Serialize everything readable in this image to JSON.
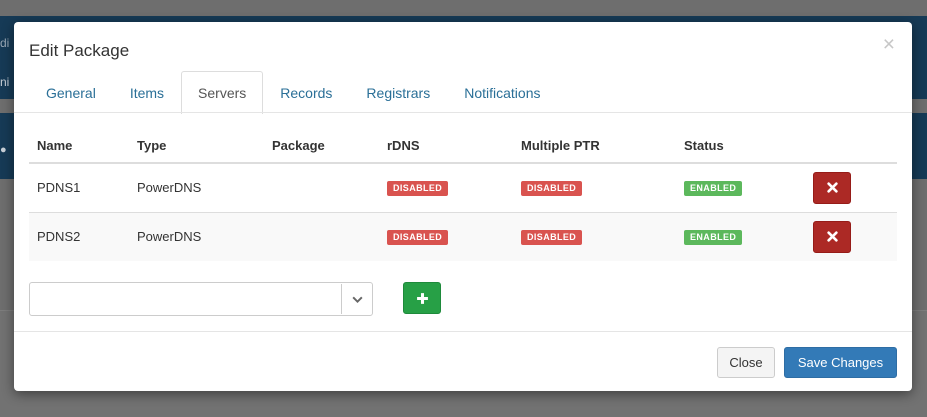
{
  "background": {
    "fragment_1": "di",
    "fragment_2": "ni"
  },
  "modal": {
    "title": "Edit Package",
    "close_glyph": "×"
  },
  "tabs": [
    {
      "label": "General",
      "active": false
    },
    {
      "label": "Items",
      "active": false
    },
    {
      "label": "Servers",
      "active": true
    },
    {
      "label": "Records",
      "active": false
    },
    {
      "label": "Registrars",
      "active": false
    },
    {
      "label": "Notifications",
      "active": false
    }
  ],
  "servers_table": {
    "columns": [
      "Name",
      "Type",
      "Package",
      "rDNS",
      "Multiple PTR",
      "Status"
    ],
    "rows": [
      {
        "name": "PDNS1",
        "type": "PowerDNS",
        "package": "",
        "rdns": "DISABLED",
        "multiple_ptr": "DISABLED",
        "status": "ENABLED"
      },
      {
        "name": "PDNS2",
        "type": "PowerDNS",
        "package": "",
        "rdns": "DISABLED",
        "multiple_ptr": "DISABLED",
        "status": "ENABLED"
      }
    ],
    "delete_icon": "times-icon"
  },
  "add_server": {
    "select_value": "",
    "button_icon": "plus-icon"
  },
  "footer": {
    "close_label": "Close",
    "save_label": "Save Changes"
  },
  "colors": {
    "disabled_badge": "#d9534f",
    "enabled_badge": "#5cb85c",
    "delete_button": "#ac2925",
    "add_button": "#27a046",
    "primary_button": "#337ab7",
    "tab_link": "#2a6f97"
  }
}
